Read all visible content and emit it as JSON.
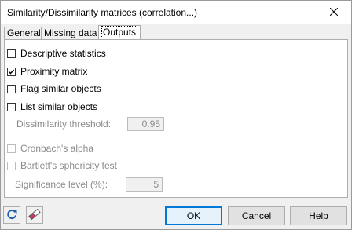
{
  "window": {
    "title": "Similarity/Dissimilarity matrices (correlation...)",
    "close_icon": "close-icon"
  },
  "tabs": [
    {
      "label": "General",
      "active": false
    },
    {
      "label": "Missing data",
      "active": false
    },
    {
      "label": "Outputs",
      "active": true
    }
  ],
  "outputs": {
    "descriptive_statistics": {
      "label": "Descriptive statistics",
      "checked": false,
      "enabled": true
    },
    "proximity_matrix": {
      "label": "Proximity matrix",
      "checked": true,
      "enabled": true
    },
    "flag_similar_objects": {
      "label": "Flag similar objects",
      "checked": false,
      "enabled": true
    },
    "list_similar_objects": {
      "label": "List similar objects",
      "checked": false,
      "enabled": true
    },
    "dissimilarity_threshold": {
      "label": "Dissimilarity threshold:",
      "value": "0.95",
      "enabled": false
    },
    "cronbachs_alpha": {
      "label": "Cronbach's alpha",
      "checked": false,
      "enabled": false
    },
    "bartletts_test": {
      "label": "Bartlett's sphericity test",
      "checked": false,
      "enabled": false
    },
    "significance_level": {
      "label": "Significance level (%):",
      "value": "5",
      "enabled": false
    }
  },
  "footer": {
    "reset_icon": "reset-icon",
    "eraser_icon": "eraser-icon",
    "ok_label": "OK",
    "cancel_label": "Cancel",
    "help_label": "Help"
  },
  "colors": {
    "accent": "#0078d7",
    "dialog_bg": "#f0f0f0",
    "panel_bg": "#ffffff",
    "disabled_text": "#8a8a8a"
  }
}
